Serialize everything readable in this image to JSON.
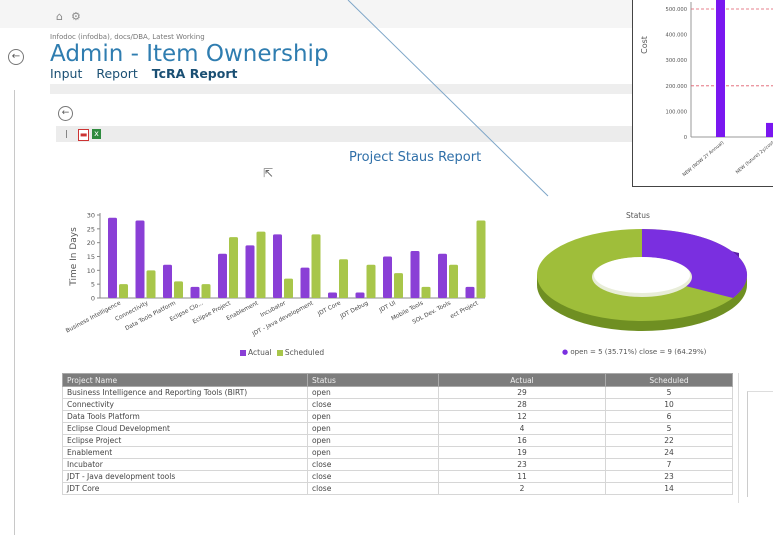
{
  "header": {
    "breadcrumb": "Infodoc (infodba), docs/DBA, Latest Working",
    "title": "Admin - Item Ownership",
    "tabs": [
      {
        "label": "Input",
        "active": false
      },
      {
        "label": "Report",
        "active": false
      },
      {
        "label": "TcRA Report",
        "active": true
      }
    ]
  },
  "report": {
    "title": "Project Staus Report"
  },
  "bar_chart": {
    "ylabel": "Time In Days",
    "yticks": [
      "0",
      "5",
      "10",
      "15",
      "20",
      "25",
      "30"
    ],
    "legend": [
      "Actual",
      "Scheduled"
    ]
  },
  "donut_chart": {
    "title": "Status",
    "legend": "open = 5 (35.71%)  close = 9 (64.29%)"
  },
  "inset_chart": {
    "ylabel": "Cost",
    "yticks": [
      "0",
      "100.000",
      "200.000",
      "300.000",
      "400.000",
      "500.000"
    ],
    "xlabels": [
      "NEW (NOW 2Y Annual)",
      "NEW (future) 2y/cost"
    ]
  },
  "table": {
    "columns": [
      "Project Name",
      "Status",
      "Actual",
      "Scheduled"
    ],
    "rows": [
      [
        "Business Intelligence and Reporting Tools (BIRT)",
        "open",
        "29",
        "5"
      ],
      [
        "Connectivity",
        "close",
        "28",
        "10"
      ],
      [
        "Data Tools Platform",
        "open",
        "12",
        "6"
      ],
      [
        "Eclipse Cloud Development",
        "open",
        "4",
        "5"
      ],
      [
        "Eclipse Project",
        "open",
        "16",
        "22"
      ],
      [
        "Enablement",
        "open",
        "19",
        "24"
      ],
      [
        "Incubator",
        "close",
        "23",
        "7"
      ],
      [
        "JDT - Java development tools",
        "close",
        "11",
        "23"
      ],
      [
        "JDT Core",
        "close",
        "2",
        "14"
      ]
    ]
  },
  "chart_data": [
    {
      "type": "bar",
      "ylabel": "Time In Days",
      "ylim": [
        0,
        30
      ],
      "categories": [
        "Business Intelligence",
        "Connectivity",
        "Data Tools Platform",
        "Eclipse Clo...",
        "Eclipse Project",
        "Enablement",
        "Incubator",
        "JDT - Java development",
        "JDT Core",
        "JDT Debug",
        "JDT UI",
        "Mobile Tools",
        "SOL Dev. Tools",
        "ect Project"
      ],
      "series": [
        {
          "name": "Actual",
          "values": [
            29,
            28,
            12,
            4,
            16,
            19,
            23,
            11,
            2,
            2,
            15,
            17,
            16,
            4
          ]
        },
        {
          "name": "Scheduled",
          "values": [
            5,
            10,
            6,
            5,
            22,
            24,
            7,
            23,
            14,
            12,
            9,
            4,
            12,
            28
          ]
        }
      ],
      "colors": {
        "Actual": "#8a3fd6",
        "Scheduled": "#a8c64a"
      },
      "legend": "bottom"
    },
    {
      "type": "pie",
      "title": "Status",
      "slices": [
        {
          "label": "open",
          "value": 5,
          "percent": 35.71
        },
        {
          "label": "close",
          "value": 9,
          "percent": 64.29
        }
      ],
      "colors": {
        "open": "#7a2fe0",
        "close": "#9fbe3a"
      }
    },
    {
      "type": "bar",
      "ylabel": "Cost",
      "ylim": [
        0,
        500000
      ],
      "categories": [
        "NEW (NOW 2Y Annual)",
        "NEW (future) 2y/cost"
      ],
      "values": [
        560000,
        55000
      ]
    }
  ]
}
